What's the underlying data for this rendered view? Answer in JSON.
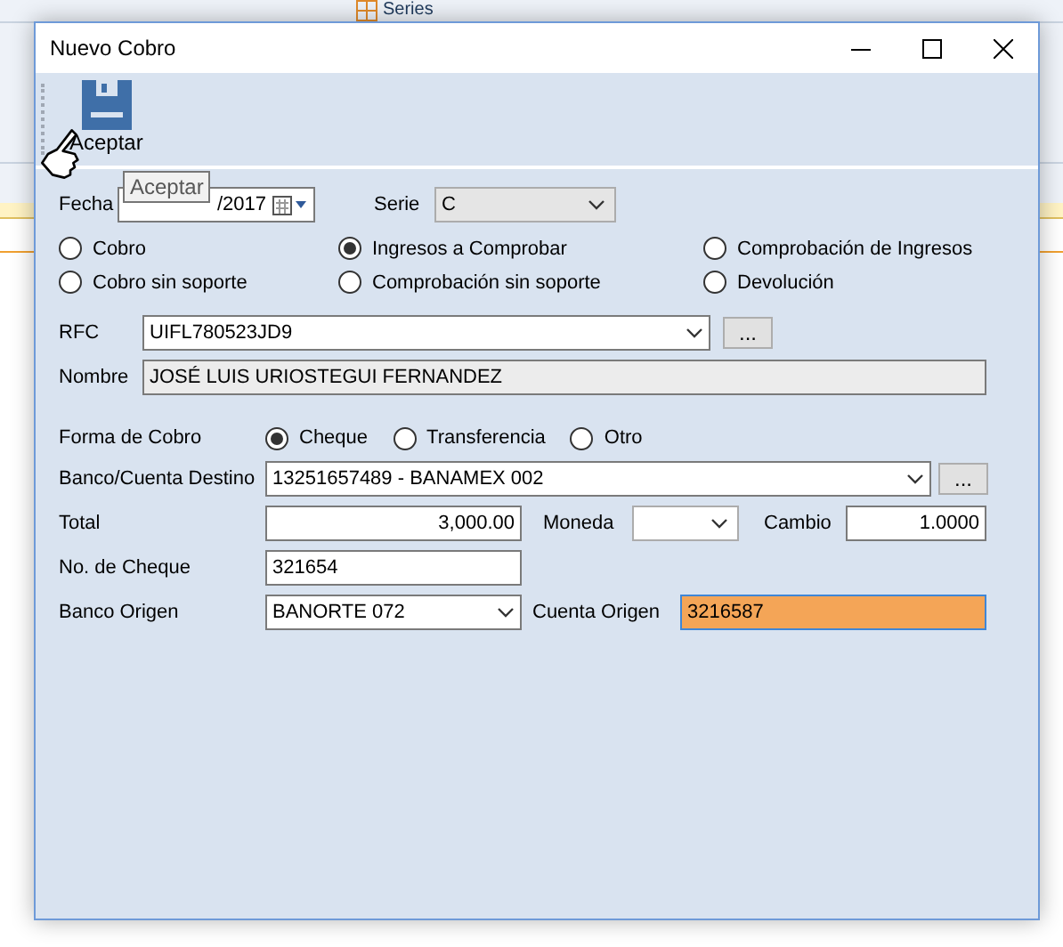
{
  "background_app": {
    "toolbar": [
      "Series"
    ]
  },
  "window": {
    "title": "Nuevo Cobro"
  },
  "toolbar": {
    "buttons": [
      {
        "label": "Aceptar"
      }
    ],
    "tooltip": "Aceptar"
  },
  "fecha": {
    "label": "Fecha",
    "value": "/2017"
  },
  "serie": {
    "label": "Serie",
    "value": "C"
  },
  "tipo": [
    {
      "label": "Cobro",
      "selected": false
    },
    {
      "label": "Ingresos a Comprobar",
      "selected": true
    },
    {
      "label": "Comprobación de Ingresos",
      "selected": false
    },
    {
      "label": "Cobro sin soporte",
      "selected": false
    },
    {
      "label": "Comprobación sin soporte",
      "selected": false
    },
    {
      "label": "Devolución",
      "selected": false
    }
  ],
  "rfc": {
    "label": "RFC",
    "value": "UIFL780523JD9",
    "button": "..."
  },
  "nombre": {
    "label": "Nombre",
    "value": "JOSÉ LUIS URIOSTEGUI FERNANDEZ"
  },
  "forma_de_cobro": {
    "label": "Forma de Cobro",
    "options": [
      {
        "label": "Cheque",
        "selected": true
      },
      {
        "label": "Transferencia",
        "selected": false
      },
      {
        "label": "Otro",
        "selected": false
      }
    ]
  },
  "banco_destino": {
    "label": "Banco/Cuenta Destino",
    "value": "13251657489 - BANAMEX  002",
    "button": "..."
  },
  "total": {
    "label": "Total",
    "value": "3,000.00"
  },
  "moneda": {
    "label": "Moneda"
  },
  "cambio": {
    "label": "Cambio",
    "value": "1.0000"
  },
  "no_cheque": {
    "label": "No. de Cheque",
    "value": "321654"
  },
  "banco_origen": {
    "label": "Banco Origen",
    "value": "BANORTE  072"
  },
  "cuenta_origen": {
    "label": "Cuenta Origen",
    "value": "3216587",
    "highlighted": true
  }
}
